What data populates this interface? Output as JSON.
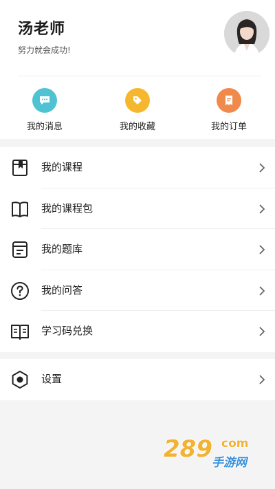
{
  "profile": {
    "name": "汤老师",
    "motto": "努力就会成功!",
    "avatar_icon": "teacher-avatar"
  },
  "quick_actions": [
    {
      "label": "我的消息",
      "icon": "chat-bubble-icon",
      "color": "#4fc3d2"
    },
    {
      "label": "我的收藏",
      "icon": "tag-icon",
      "color": "#f5b72e"
    },
    {
      "label": "我的订单",
      "icon": "receipt-icon",
      "color": "#f08a4b"
    }
  ],
  "menu": [
    {
      "label": "我的课程",
      "icon": "course-book-icon"
    },
    {
      "label": "我的课程包",
      "icon": "open-book-icon"
    },
    {
      "label": "我的题库",
      "icon": "question-bank-icon"
    },
    {
      "label": "我的问答",
      "icon": "question-mark-icon"
    },
    {
      "label": "学习码兑换",
      "icon": "redeem-book-icon"
    }
  ],
  "settings": {
    "label": "设置",
    "icon": "hexagon-settings-icon"
  },
  "watermark": {
    "number": "289",
    "domain": "com",
    "text": "手游网"
  }
}
